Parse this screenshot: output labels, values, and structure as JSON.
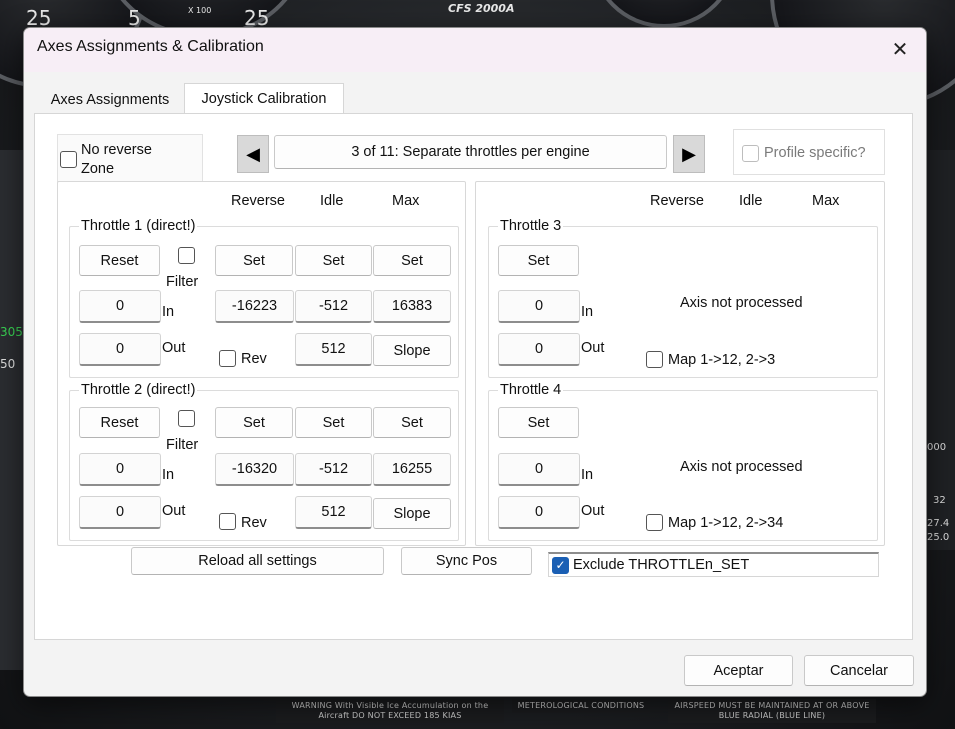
{
  "backdrop": {
    "gauge_top_left": "25",
    "gauge_top_mid_a": "5",
    "gauge_top_mid_b": "25",
    "gauge_label_x100": "X 100",
    "fms_label": "CFS 2000A",
    "placard_warning": "WARNING With Visible Ice Accumulation on the Aircraft DO NOT EXCEED 185 KIAS",
    "placard_met": "METEROLOGICAL CONDITIONS",
    "placard_airspeed": "AIRSPEED MUST BE MAINTAINED AT OR ABOVE BLUE RADIAL (BLUE LINE)",
    "left_numbers": [
      "305",
      "50"
    ],
    "right_numbers": [
      "000",
      "32",
      "27.4",
      "25.0"
    ]
  },
  "dialog": {
    "title": "Axes Assignments & Calibration",
    "close_glyph": "✕",
    "tabs": [
      {
        "label": "Axes Assignments",
        "active": false
      },
      {
        "label": "Joystick Calibration",
        "active": true
      }
    ],
    "no_reverse_zone_label": "No reverse Zone",
    "nav": {
      "prev_glyph": "◀",
      "next_glyph": "▶",
      "page_label": "3 of 11: Separate throttles per engine"
    },
    "profile_specific_label": "Profile specific?",
    "headers": {
      "reverse": "Reverse",
      "idle": "Idle",
      "max": "Max"
    },
    "throttle1": {
      "title": "Throttle 1 (direct!)",
      "reset": "Reset",
      "filter": "Filter",
      "set_reverse": "Set",
      "set_idle": "Set",
      "set_max": "Set",
      "in_value": "0",
      "in_label": "In",
      "out_value": "0",
      "out_label": "Out",
      "reverse_value": "-16223",
      "idle_value": "-512",
      "max_value": "16383",
      "rev_label": "Rev",
      "idle_out_value": "512",
      "slope": "Slope"
    },
    "throttle2": {
      "title": "Throttle 2 (direct!)",
      "reset": "Reset",
      "filter": "Filter",
      "set_reverse": "Set",
      "set_idle": "Set",
      "set_max": "Set",
      "in_value": "0",
      "in_label": "In",
      "out_value": "0",
      "out_label": "Out",
      "reverse_value": "-16320",
      "idle_value": "-512",
      "max_value": "16255",
      "rev_label": "Rev",
      "idle_out_value": "512",
      "slope": "Slope"
    },
    "throttle3": {
      "title": "Throttle 3",
      "set": "Set",
      "in_value": "0",
      "in_label": "In",
      "out_value": "0",
      "out_label": "Out",
      "status": "Axis not processed",
      "map_label": "Map 1->12, 2->3"
    },
    "throttle4": {
      "title": "Throttle 4",
      "set": "Set",
      "in_value": "0",
      "in_label": "In",
      "out_value": "0",
      "out_label": "Out",
      "status": "Axis not processed",
      "map_label": "Map 1->12, 2->34"
    },
    "reload_label": "Reload all settings",
    "sync_label": "Sync Pos",
    "exclude_label": "Exclude THROTTLEn_SET",
    "check_glyph": "✓",
    "ok_label": "Aceptar",
    "cancel_label": "Cancelar"
  }
}
